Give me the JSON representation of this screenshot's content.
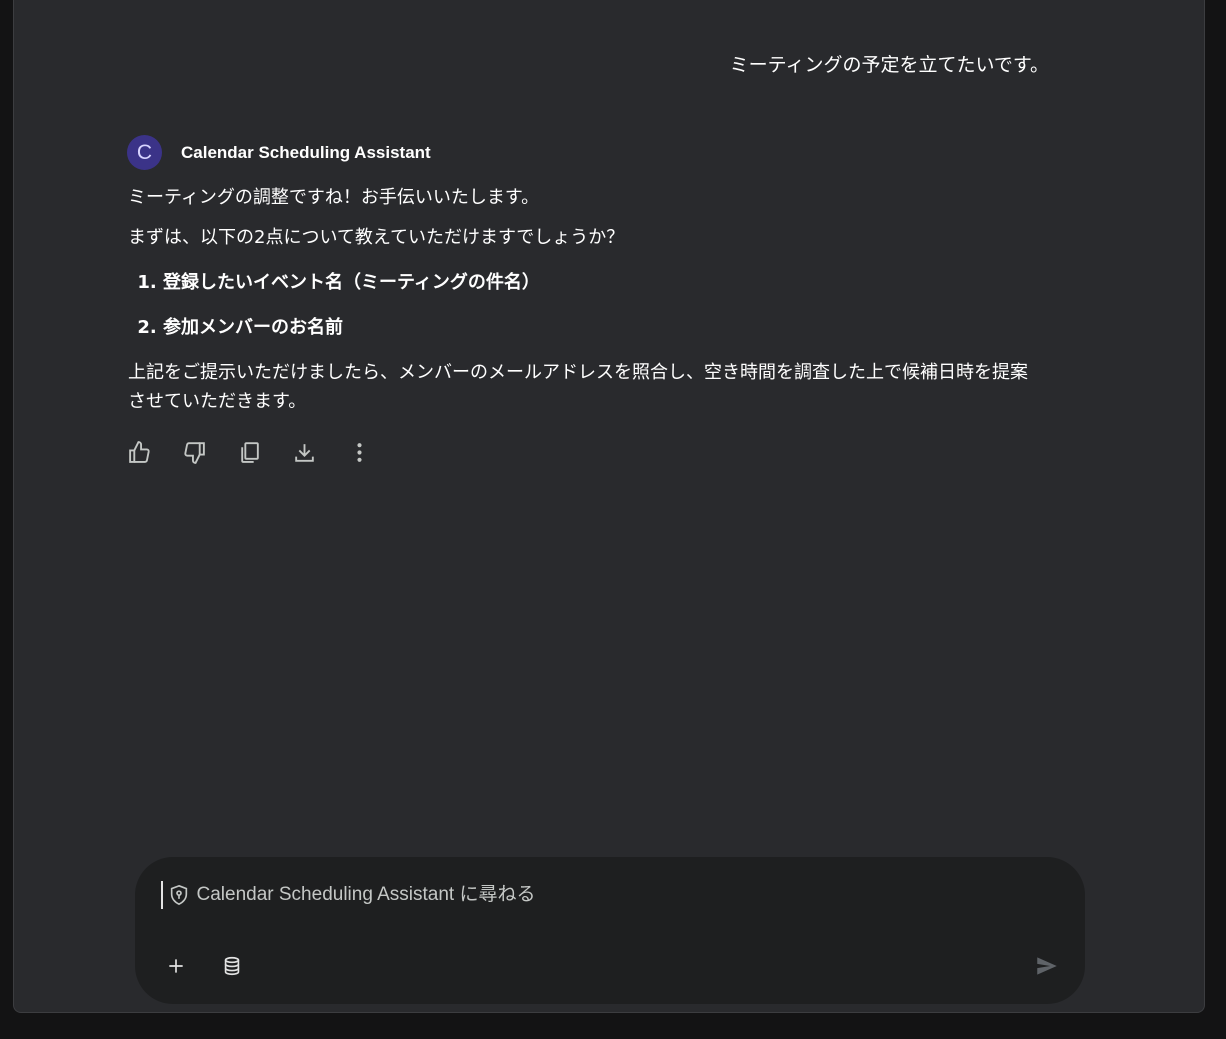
{
  "conversation": {
    "user_message": "ミーティングの予定を立てたいです。",
    "assistant": {
      "avatar_letter": "C",
      "name": "Calendar Scheduling Assistant",
      "intro": "ミーティングの調整ですね！お手伝いいたします。",
      "question": "まずは、以下の2点について教えていただけますでしょうか？",
      "items": [
        "登録したいイベント名（ミーティングの件名）",
        "参加メンバーのお名前"
      ],
      "closing": "上記をご提示いただけましたら、メンバーのメールアドレスを照合し、空き時間を調査した上で候補日時を提案させていただきます。"
    },
    "actions": [
      "thumbs-up-icon",
      "thumbs-down-icon",
      "copy-icon",
      "download-icon",
      "more-vert-icon"
    ]
  },
  "input": {
    "placeholder": "Calendar Scheduling Assistant に尋ねる",
    "value": ""
  },
  "colors": {
    "window_bg": "#292a2d",
    "page_bg": "#131314",
    "input_bg": "#1e1f20",
    "avatar_bg": "#3b3388"
  }
}
